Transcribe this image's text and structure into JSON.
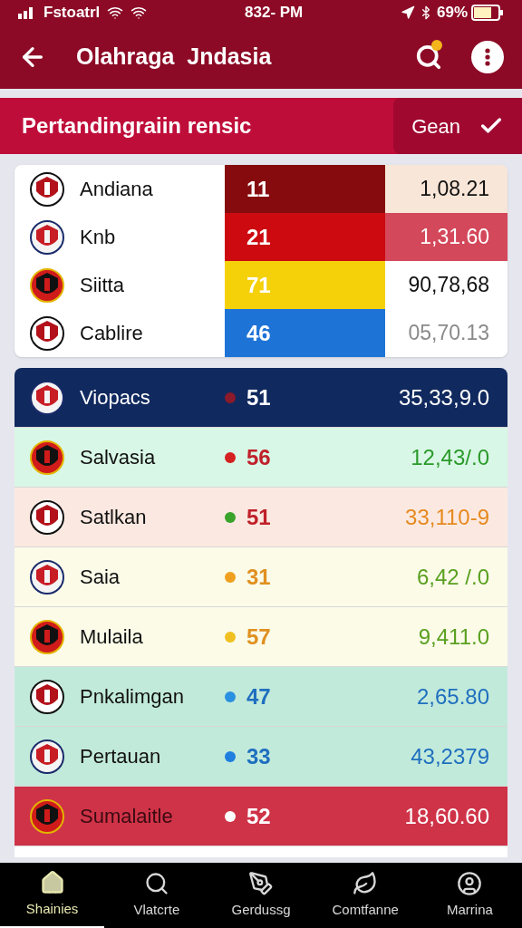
{
  "status_bar": {
    "carrier": "Fstoatrl",
    "time": "832- PM",
    "battery": "69%"
  },
  "app_bar": {
    "title": "Olahraga  Jndasia"
  },
  "section": {
    "title": "Pertandingraiin rensic",
    "button": "Gean"
  },
  "top_table": [
    {
      "name": "Andiana",
      "score": "11",
      "value": "1,08.21",
      "color": "#850b0f",
      "kind": "tinted"
    },
    {
      "name": "Knb",
      "score": "21",
      "value": "1,31.60",
      "color": "#cc0a10",
      "kind": "highlight"
    },
    {
      "name": "Siitta",
      "score": "71",
      "value": "90,78,68",
      "color": "#f5d10a",
      "kind": "plain"
    },
    {
      "name": "Cablire",
      "score": "46",
      "value": "05,70.13",
      "color": "#1e74d6",
      "kind": "faded"
    }
  ],
  "standings": [
    {
      "name": "Viopacs",
      "score": "51",
      "value": "35,33,9.0",
      "color": "#8b1a2a",
      "kind": "dark"
    },
    {
      "name": "Salvasia",
      "score": "56",
      "value": "12,43/.0",
      "color": "#d42020",
      "kind": "green"
    },
    {
      "name": "Satlkan",
      "score": "51",
      "value": "33,110-9",
      "color": "#3aa32a",
      "kind": "peach"
    },
    {
      "name": "Saia",
      "score": "31",
      "value": "6,42 /.0",
      "color": "#f0a020",
      "kind": "cream"
    },
    {
      "name": "Mulaila",
      "score": "57",
      "value": "9,411.0",
      "color": "#f0c020",
      "kind": "cream"
    },
    {
      "name": "Pnkalimgan",
      "score": "47",
      "value": "2,65.80",
      "color": "#2a90e0",
      "kind": "mint"
    },
    {
      "name": "Pertauan",
      "score": "33",
      "value": "43,2379",
      "color": "#1f7fdf",
      "kind": "mint"
    },
    {
      "name": "Sumalaitle",
      "score": "52",
      "value": "18,60.60",
      "color": "#ffffff",
      "kind": "red"
    }
  ],
  "bottom_nav": [
    {
      "label": "Shainies",
      "selected": true
    },
    {
      "label": "Vlatcrte",
      "selected": false
    },
    {
      "label": "Gerdussg",
      "selected": false
    },
    {
      "label": "Comtfanne",
      "selected": false
    },
    {
      "label": "Marrina",
      "selected": false
    }
  ]
}
